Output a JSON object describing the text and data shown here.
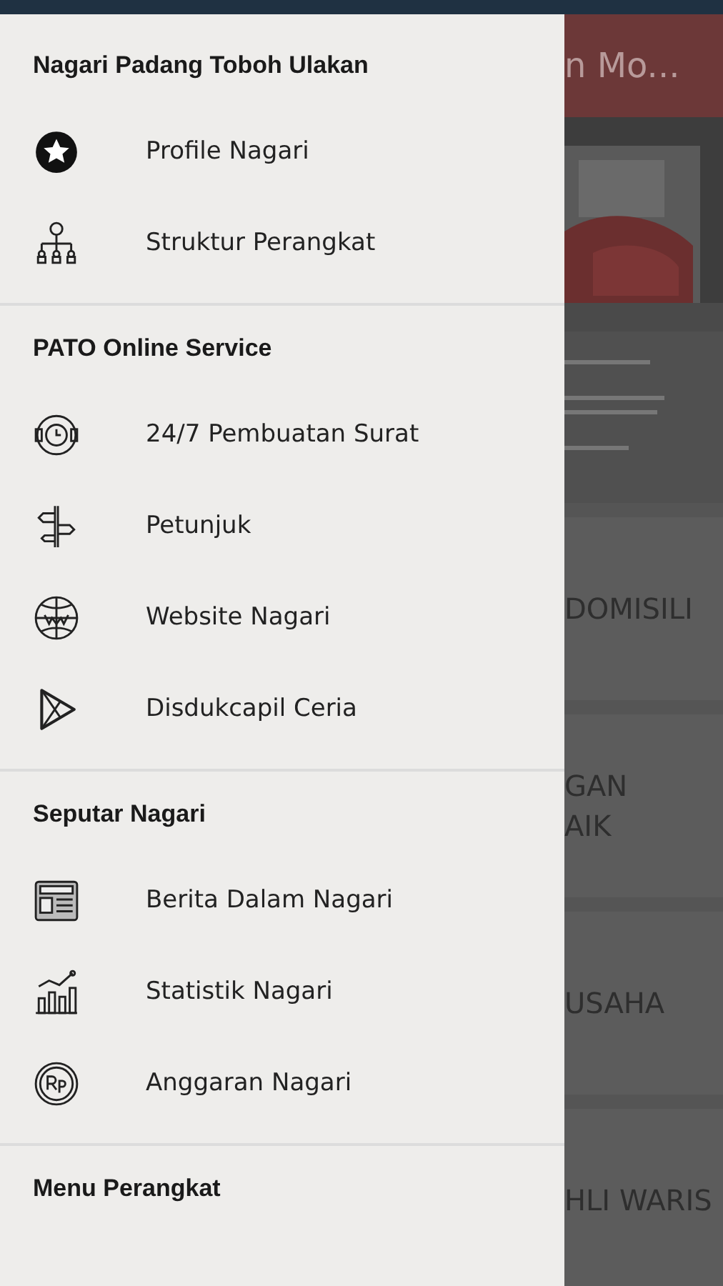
{
  "drawer": {
    "sections": [
      {
        "header": "Nagari Padang Toboh Ulakan",
        "items": [
          {
            "label": "Profile Nagari"
          },
          {
            "label": "Struktur Perangkat"
          }
        ]
      },
      {
        "header": "PATO Online Service",
        "items": [
          {
            "label": "24/7 Pembuatan Surat"
          },
          {
            "label": "Petunjuk"
          },
          {
            "label": "Website Nagari"
          },
          {
            "label": "Disdukcapil Ceria"
          }
        ]
      },
      {
        "header": "Seputar Nagari",
        "items": [
          {
            "label": "Berita Dalam Nagari"
          },
          {
            "label": "Statistik Nagari"
          },
          {
            "label": "Anggaran Nagari"
          }
        ]
      },
      {
        "header": "Menu Perangkat"
      }
    ]
  },
  "background": {
    "app_bar_title": "n Mo...",
    "cards": [
      {
        "lines": [
          "DOMISILI"
        ]
      },
      {
        "lines": [
          "GAN",
          "AIK"
        ]
      },
      {
        "lines": [
          "USAHA"
        ]
      },
      {
        "lines": [
          "HLI WARIS"
        ]
      }
    ]
  }
}
